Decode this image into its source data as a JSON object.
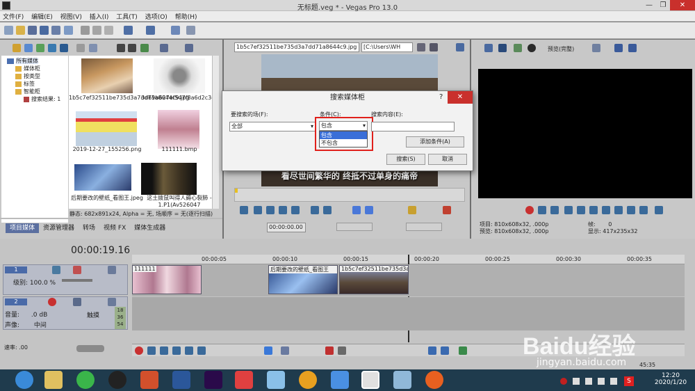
{
  "window": {
    "title": "无标题.veg * - Vegas Pro 13.0",
    "btn_min": "—",
    "btn_max": "❐",
    "btn_close": "✕"
  },
  "menu": [
    "文件(F)",
    "编辑(E)",
    "视图(V)",
    "插入(I)",
    "工具(T)",
    "选项(O)",
    "帮助(H)"
  ],
  "tree": [
    "所有媒体",
    "媒体柜",
    "按类型",
    "标签",
    "智能柜",
    "搜索结果: 1"
  ],
  "media": [
    {
      "name": "1b5c7ef32511be735d3a7dd71a8644c9.jpg"
    },
    {
      "name": "3d69b627ef547f8a6d2c3eb494aa41b.jpg"
    },
    {
      "name": "2019-12-27_155256.png"
    },
    {
      "name": "111111.bmp"
    },
    {
      "name": "后期要改的壁纸_看图王.jpeg"
    },
    {
      "name": "这土拨鼠叫得人薅心裂肺 - 1.P1(Av526047"
    }
  ],
  "status_line": "静态: 682x891x24, Alpha = 无, 场顺序 = 无(逐行扫描)",
  "left_tabs": [
    "项目媒体",
    "资源管理器",
    "转场",
    "视频 FX",
    "媒体生成器"
  ],
  "trimmer": {
    "file": "1b5c7ef32511be735d3a7dd71a8644c9.jpg",
    "path": "[C:\\Users\\WH",
    "subtitle": "看尽世间繁华的 终抵不过单身的痛帝",
    "timecode": "00:00:00.00"
  },
  "preview": {
    "mode": "预览(完整)",
    "project_label": "项目:",
    "project": "810x608x32, .000p",
    "preview_label": "预览:",
    "preview": "810x608x32, .000p",
    "frame_label": "帧:",
    "frame": "0",
    "display_label": "显示:",
    "display": "417x235x32"
  },
  "timeline": {
    "timecode": "00:00:19.16",
    "ticks": [
      "00:00:05",
      "00:00:10",
      "00:00:15",
      "00:00:20",
      "00:00:25",
      "00:00:30",
      "00:00:35"
    ],
    "track1_num": "1",
    "track1_level_label": "级别:",
    "track1_level": "100.0 %",
    "track2_num": "2",
    "volume_label": "音量:",
    "volume": ".0 dB",
    "pan_label": "声像:",
    "pan": "中间",
    "touch": "触摸",
    "meter": [
      "18",
      "36",
      "54"
    ],
    "clip1": "111111",
    "clip2": "后期要改的壁纸_看图王",
    "clip3": "1b5c7ef32511be735d3a",
    "rate_label": "速率:",
    "rate": ".00",
    "end_time": "45:35"
  },
  "dialog": {
    "title": "搜索媒体柜",
    "help": "?",
    "close": "✕",
    "field_label": "要搜索的场(F):",
    "field_value": "全部",
    "cond_label": "条件(C):",
    "cond_value": "包含",
    "content_label": "搜索内容(E):",
    "options": [
      "包含",
      "不包含"
    ],
    "add_btn": "添加条件(A)",
    "search_btn": "搜索(S)",
    "cancel_btn": "取消"
  },
  "watermark": {
    "logo": "Baidu经验",
    "url": "jingyan.baidu.com"
  },
  "taskbar": {
    "time": "12:20",
    "date": "2020/1/20",
    "ime": "S"
  },
  "colors": {
    "accent": "#5b6fa0",
    "highlight_red": "#e0201b",
    "selected_blue": "#3a6fd8"
  }
}
